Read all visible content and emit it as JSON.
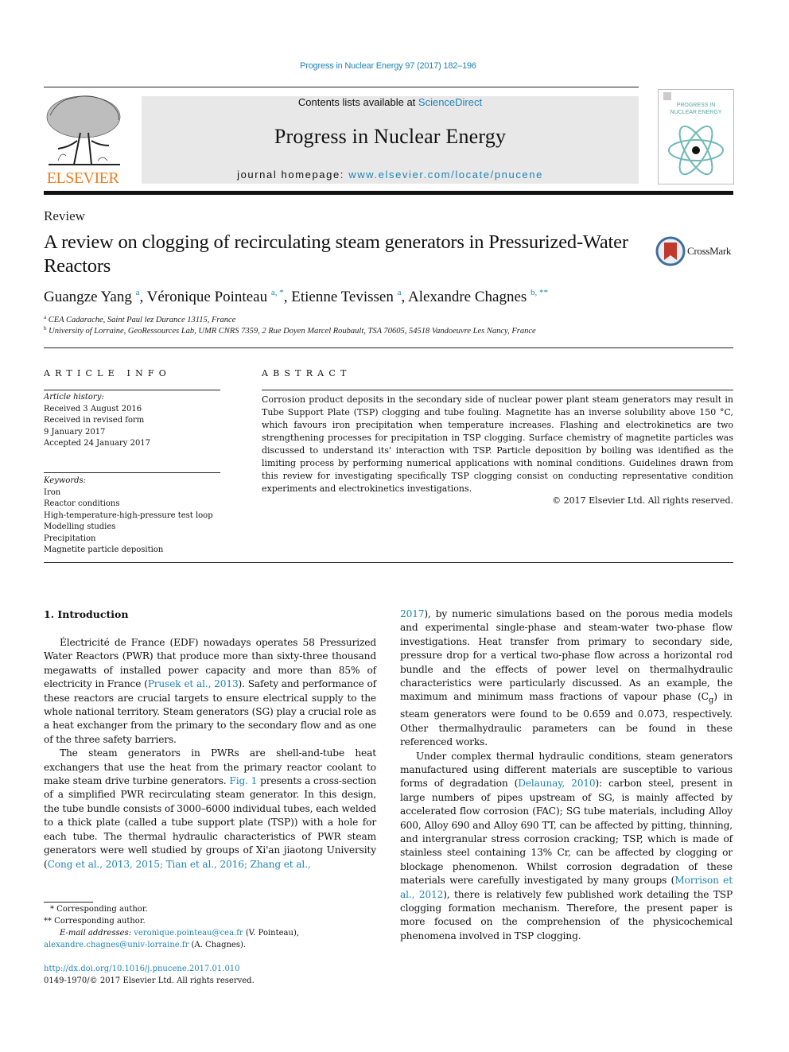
{
  "header": {
    "journal_reference": "Progress in Nuclear Energy 97 (2017) 182–196",
    "contents_prefix": "Contents lists available at ",
    "contents_link": "ScienceDirect",
    "journal_title": "Progress in Nuclear Energy",
    "homepage_prefix": "journal homepage: ",
    "homepage_link": "www.elsevier.com/locate/pnucene",
    "publisher_logo_text": "ELSEVIER",
    "cover_title_line1": "PROGRESS IN",
    "cover_title_line2": "NUCLEAR ENERGY",
    "colors": {
      "link": "#1f84b6",
      "elsevier_orange": "#f07d1f",
      "banner_gray": "#e8e8e8",
      "cover_teal": "#4fa7a5",
      "crossmark_red": "#c0392b",
      "crossmark_blue": "#3f6e9c"
    }
  },
  "article": {
    "type_label": "Review",
    "title": "A review on clogging of recirculating steam generators in Pressurized-Water Reactors",
    "crossmark_label": "CrossMark",
    "authors": [
      {
        "name": "Guangze Yang",
        "marks": "a"
      },
      {
        "name": "Véronique Pointeau",
        "marks": "a, *"
      },
      {
        "name": "Etienne Tevissen",
        "marks": "a"
      },
      {
        "name": "Alexandre Chagnes",
        "marks": "b, **"
      }
    ],
    "affiliations": [
      {
        "mark": "a",
        "text": "CEA Cadarache, Saint Paul lez Durance 13115, France"
      },
      {
        "mark": "b",
        "text": "University of Lorraine, GeoRessources Lab, UMR CNRS 7359, 2 Rue Doyen Marcel Roubault, TSA 70605, 54518 Vandoeuvre Les Nancy, France"
      }
    ]
  },
  "article_info": {
    "heading": "ARTICLE INFO",
    "history_label": "Article history:",
    "history": [
      "Received 3 August 2016",
      "Received in revised form",
      "9 January 2017",
      "Accepted 24 January 2017"
    ],
    "keywords_label": "Keywords:",
    "keywords": [
      "Iron",
      "Reactor conditions",
      "High-temperature-high-pressure test loop",
      "Modelling studies",
      "Precipitation",
      "Magnetite particle deposition"
    ]
  },
  "abstract": {
    "heading": "ABSTRACT",
    "text": "Corrosion product deposits in the secondary side of nuclear power plant steam generators may result in Tube Support Plate (TSP) clogging and tube fouling. Magnetite has an inverse solubility above 150 °C, which favours iron precipitation when temperature increases. Flashing and electrokinetics are two strengthening processes for precipitation in TSP clogging. Surface chemistry of magnetite particles was discussed to understand its' interaction with TSP. Particle deposition by boiling was identified as the limiting process by performing numerical applications with nominal conditions. Guidelines drawn from this review for investigating specifically TSP clogging consist on conducting representative condition experiments and electrokinetics investigations.",
    "copyright": "© 2017 Elsevier Ltd. All rights reserved."
  },
  "body": {
    "section_heading": "1.  Introduction",
    "p1_a": "Électricité de France (EDF) nowadays operates 58 Pressurized Water Reactors (PWR) that produce more than sixty-three thousand megawatts of installed power capacity and more than 85% of electricity in France (",
    "p1_link": "Prusek et al., 2013",
    "p1_b": "). Safety and performance of these reactors are crucial targets to ensure electrical supply to the whole national territory. Steam generators (SG) play a crucial role as a heat exchanger from the primary to the secondary flow and as one of the three safety barriers.",
    "p2_a": "The steam generators in PWRs are shell-and-tube heat exchangers that use the heat from the primary reactor coolant to make steam drive turbine generators. ",
    "p2_link1": "Fig. 1",
    "p2_b": " presents a cross-section of a simplified PWR recirculating steam generator. In this design, the tube bundle consists of 3000–6000 individual tubes, each welded to a thick plate (called a tube support plate (TSP)) with a hole for each tube. The thermal hydraulic characteristics of PWR steam generators were well studied by groups of Xi'an jiaotong University (",
    "p2_link2": "Cong et al., 2013, 2015; Tian et al., 2016; Zhang et al.,",
    "p3_link": "2017",
    "p3_a": "), by numeric simulations based on the porous media models and experimental single-phase and steam-water two-phase flow investigations. Heat transfer from primary to secondary side, pressure drop for a vertical two-phase flow across a horizontal rod bundle and the effects of power level on thermalhydraulic characteristics were particularly discussed. As an example, the maximum and minimum mass fractions of vapour phase (C",
    "p3_sub": "g",
    "p3_b": ") in steam generators were found to be 0.659 and 0.073, respectively. Other thermalhydraulic parameters can be found in these referenced works.",
    "p4_a": "Under complex thermal hydraulic conditions, steam generators manufactured using different materials are susceptible to various forms of degradation (",
    "p4_link1": "Delaunay, 2010",
    "p4_b": "): carbon steel, present in large numbers of pipes upstream of SG, is mainly affected by accelerated flow corrosion (FAC); SG tube materials, including Alloy 600, Alloy 690 and Alloy 690 TT, can be affected by pitting, thinning, and intergranular stress corrosion cracking; TSP, which is made of stainless steel containing 13% Cr, can be affected by clogging or blockage phenomenon. Whilst corrosion degradation of these materials were carefully investigated by many groups (",
    "p4_link2": "Morrison et al., 2012",
    "p4_c": "), there is relatively few published work detailing the TSP clogging formation mechanism. Therefore, the present paper is more focused on the comprehension of the physicochemical phenomena involved in TSP clogging."
  },
  "footnotes": {
    "star1": "* Corresponding author.",
    "star2": "** Corresponding author.",
    "email_label": "E-mail addresses: ",
    "email1": "veronique.pointeau@cea.fr",
    "email1_owner": " (V. Pointeau), ",
    "email2": "alexandre.chagnes@univ-lorraine.fr",
    "email2_owner": " (A. Chagnes).",
    "doi": "http://dx.doi.org/10.1016/j.pnucene.2017.01.010",
    "issn": "0149-1970/© 2017 Elsevier Ltd. All rights reserved."
  }
}
